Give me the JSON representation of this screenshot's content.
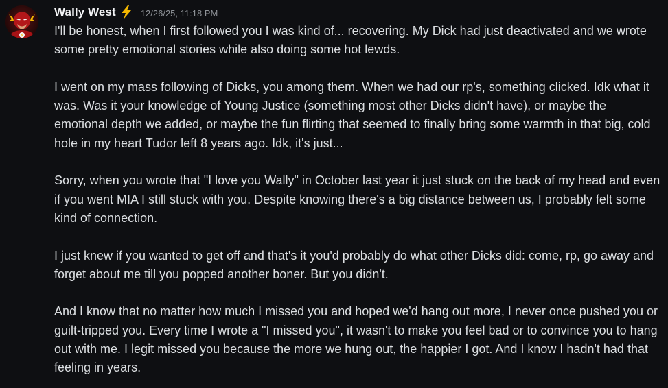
{
  "message": {
    "username": "Wally West",
    "username_badge_icon": "lightning-bolt-emoji",
    "timestamp": "12/26/25, 11:18 PM",
    "avatar_icon": "flash-avatar-icon",
    "paragraphs": [
      "I'll be honest, when I first followed you I was kind of... recovering. My Dick had just deactivated and we wrote some pretty emotional stories while also doing some hot lewds.",
      "I went on my mass following of Dicks, you among them. When we had our rp's, something clicked. Idk what it was. Was it your knowledge of Young Justice (something most other Dicks didn't have), or maybe the emotional depth we added, or maybe the fun flirting that seemed to finally bring some warmth in that big, cold hole in my heart Tudor left 8 years ago. Idk, it's just...",
      "Sorry, when you wrote that \"I love you Wally\" in October last year it just stuck on the back of my head and even if you went MIA I still stuck with you. Despite knowing there's a big distance between us, I probably felt some kind of connection.",
      "I just knew if you wanted to get off and that's it you'd probably do what other Dicks did: come, rp, go away and forget about me till you popped another boner. But you didn't.",
      "And I know that no matter how much I missed you and hoped we'd hang out more, I never once pushed you or guilt-tripped you. Every time I wrote a \"I missed you\", it wasn't to make you feel bad or to convince you to hang out with me. I legit missed you because the more we hung out, the happier I got. And I know I hadn't had that feeling in years."
    ]
  },
  "colors": {
    "background": "#0e0f12",
    "username": "#f2f3f5",
    "text": "#dbdee1",
    "timestamp": "#8e9297",
    "bolt": "#f5b800"
  }
}
